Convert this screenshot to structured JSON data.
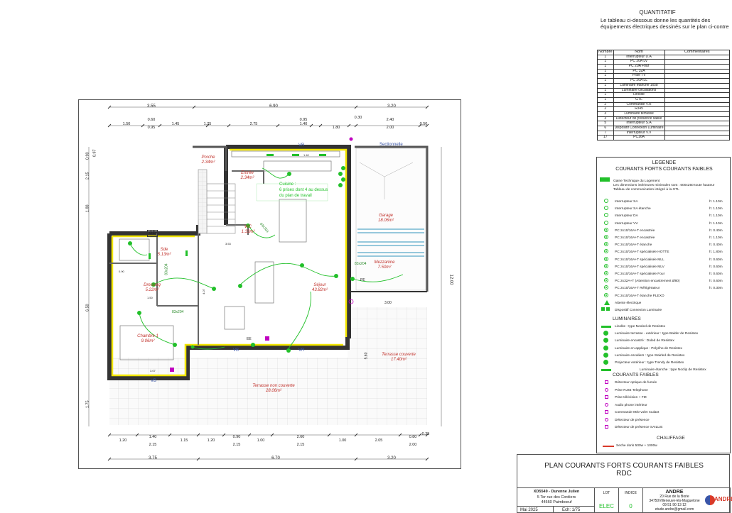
{
  "quantitatif": {
    "title": "QUANTITATIF",
    "description": "Le tableau ci-dessous donne les quantités des équipements électriques dessinés sur le plan ci-contre"
  },
  "table": {
    "headers": [
      "Nombre",
      "Nom",
      "Commentaires"
    ],
    "rows": [
      [
        "1",
        "Interrupteur D.A"
      ],
      [
        "1",
        "PC 20A LV"
      ],
      [
        "1",
        "PC 20A Four"
      ],
      [
        "1",
        "PC 32A"
      ],
      [
        "1",
        "Prise TV"
      ],
      [
        "1",
        "PC 20A LL"
      ],
      [
        "1",
        "Luminaire étanche 1x58"
      ],
      [
        "1",
        "Luminaire circulations"
      ],
      [
        "1",
        "Linolite"
      ],
      [
        "1",
        "GTL"
      ],
      [
        "2",
        "Commande V.R"
      ],
      [
        "2",
        "RJ45"
      ],
      [
        "3",
        "Luminaire terrasse"
      ],
      [
        "3",
        "Détecteur de présence saillie"
      ],
      [
        "5",
        "Interrupteur S.A"
      ],
      [
        "6",
        "Dispositif Connexion Luminaire"
      ],
      [
        "7",
        "Interrupteur V.V"
      ],
      [
        "17",
        "PC16A"
      ]
    ]
  },
  "legend": {
    "title": "LEGENDE",
    "subtitle": "COURANTS FORTS COURANTS FAIBLES",
    "gtl": {
      "title": "Gaine Technique du Logement",
      "line1": "Les dimensions intérieures minimales sont : 600x250 toute hauteur",
      "line2": "Tableau de communication intégré à la GTL"
    },
    "items": [
      {
        "label": "Interrupteur SA",
        "height": "h: 1.10m"
      },
      {
        "label": "Interrupteur SA étanche",
        "height": "h: 1.10m"
      },
      {
        "label": "Interrupteur DA",
        "height": "h: 1.10m"
      },
      {
        "label": "Interrupteur VV",
        "height": "h: 1.10m"
      },
      {
        "label": "PC 2x10/16A+T encastrée",
        "height": "h: 0.40m"
      },
      {
        "label": "PC 2x10/16A+T encastrée",
        "height": "h: 1.10m"
      },
      {
        "label": "PC 2x10/16A+T étanche",
        "height": "h: 0.40m"
      },
      {
        "label": "PC 2x10/16A+T spécialisée HOTTE",
        "height": "h: 1.80m"
      },
      {
        "label": "PC 2x10/16A+T spécialisée MLL",
        "height": "h: 0.60m"
      },
      {
        "label": "PC 2x10/16A+T spécialisée MLV",
        "height": "h: 0.60m"
      },
      {
        "label": "PC 2x10/16A+T spécialisée Four",
        "height": "h: 0.60m"
      },
      {
        "label": "PC 2x32A+T (Attention encastrement Ø80)",
        "height": "h: 0.60m"
      },
      {
        "label": "PC 2x10/16A+T Réfrigérateur",
        "height": "h: 0.30m"
      },
      {
        "label": "PC 2x10/16A+T étanche PLEXO",
        "height": ""
      },
      {
        "label": "Attente électrique",
        "height": ""
      },
      {
        "label": "Dispositif Connexion Luminaire",
        "height": ""
      }
    ],
    "luminaires_title": "LUMINAIRES",
    "luminaires": [
      "Linolite : type Neoled de Resistex",
      "Luminaire terrasse - extérieur : type Balder de Resistex",
      "Luminaire encastré : Doled de Resistex",
      "Luminaire en applique : Polyého de Resistex",
      "Luminaire escaliers : type Stairled de Resistex",
      "Projecteur extérieur : type Trendy de Resistex",
      "Luminaire étanche : type Noclip de Resistex"
    ],
    "faibles_title": "COURANTS FAIBLES",
    "faibles": [
      "Détecteur optique de fumée",
      "Prise RJ45 Telephone",
      "Prise télévision + FM",
      "Audio phone intérieur",
      "Commande M/D volet roulant",
      "Détecteur de présence",
      "Détecteur de présence SAILLIE"
    ],
    "chauffage_title": "CHAUFFAGE",
    "chauffage": "Seche doris 500w + 1000w"
  },
  "plan": {
    "dims_top_1": [
      "3.55",
      "6.90",
      "3.20"
    ],
    "dims_top_2": [
      "1.50",
      "0.60",
      "0.95",
      "1.45",
      "1.25",
      "2.75",
      "1.40",
      "0.95",
      "1.80",
      "0.30",
      "2.40",
      "2.00",
      "0.50"
    ],
    "dims_bottom_1": [
      "1.20",
      "1.40",
      "2.15",
      "1.15",
      "1.20",
      "0.90",
      "2.15",
      "1.00",
      "2.60",
      "2.15",
      "1.00",
      "2.05",
      "0.80",
      "2.00",
      "0.35"
    ],
    "dims_bottom_2": [
      "3.75",
      "6.70",
      "3.20"
    ],
    "dims_left": [
      "0.90",
      "0.97",
      "2.15",
      "1.88",
      "6.50",
      "1.75"
    ],
    "dims_right": "12.00",
    "dims_misc": [
      "3.00",
      "5.60",
      "3.07",
      "4.07",
      "0.90",
      "3.53",
      "1.40",
      "1.50"
    ],
    "rooms": [
      {
        "name": "Porche",
        "area": "2.34m²"
      },
      {
        "name": "Entrée",
        "area": "2.34m²"
      },
      {
        "name": "WC",
        "area": "1.33m²"
      },
      {
        "name": "Garage",
        "area": "18.06m²"
      },
      {
        "name": "Mezzanine",
        "area": "7.50m²"
      },
      {
        "name": "Séjour",
        "area": "43.82m²"
      },
      {
        "name": "Sde",
        "area": "5.13m²"
      },
      {
        "name": "Dressing",
        "area": "5.22m²"
      },
      {
        "name": "Chambre 1",
        "area": "9.06m²"
      },
      {
        "name": "Terrasse couverte",
        "area": "17.40m²"
      },
      {
        "name": "Terrasse non couverte",
        "area": "28.06m²"
      }
    ],
    "tags": {
      "gd": "GD",
      "vr": "VR",
      "vb": "VB",
      "sectionnelle": "Sectionnelle",
      "ee": "EE",
      "pe": "PE",
      "door": "83x204",
      "door2": "83x204",
      "door3": "83x204",
      "door4": "63x204"
    },
    "note_cuisine": "Cuisine :",
    "note_line1": "6 prises dont 4 au dessus",
    "note_line2": "du plan de travail"
  },
  "title_block": {
    "title_line1": "PLAN COURANTS FORTS COURANTS FAIBLES",
    "title_line2": "RDC",
    "client_ref": "XD5549 - Durenne Julien",
    "address1": "5 Ter rue des Cordiers",
    "address2": "44560 Paimboeuf",
    "date": "Mai 2025",
    "scale": "Ech: 1/75",
    "lot_label": "LOT",
    "lot_value": "ELEC",
    "indice_label": "INDICE",
    "indice_value": "0",
    "company": "ANDRE",
    "company_addr1": "20 Rue de la Borie",
    "company_addr2": "34750Villeneuve-lès-Maguelone",
    "company_phone": "09 51 90 13 12",
    "company_email": "etude.andre@gmail.com",
    "logo_text": "ANDRÉ"
  },
  "colors": {
    "green": "#22c02a",
    "yellow": "#f2e600",
    "magenta": "#c000c0",
    "blue": "#3a55a8",
    "red": "#d83a2a",
    "cyan": "#5aa8c8"
  }
}
